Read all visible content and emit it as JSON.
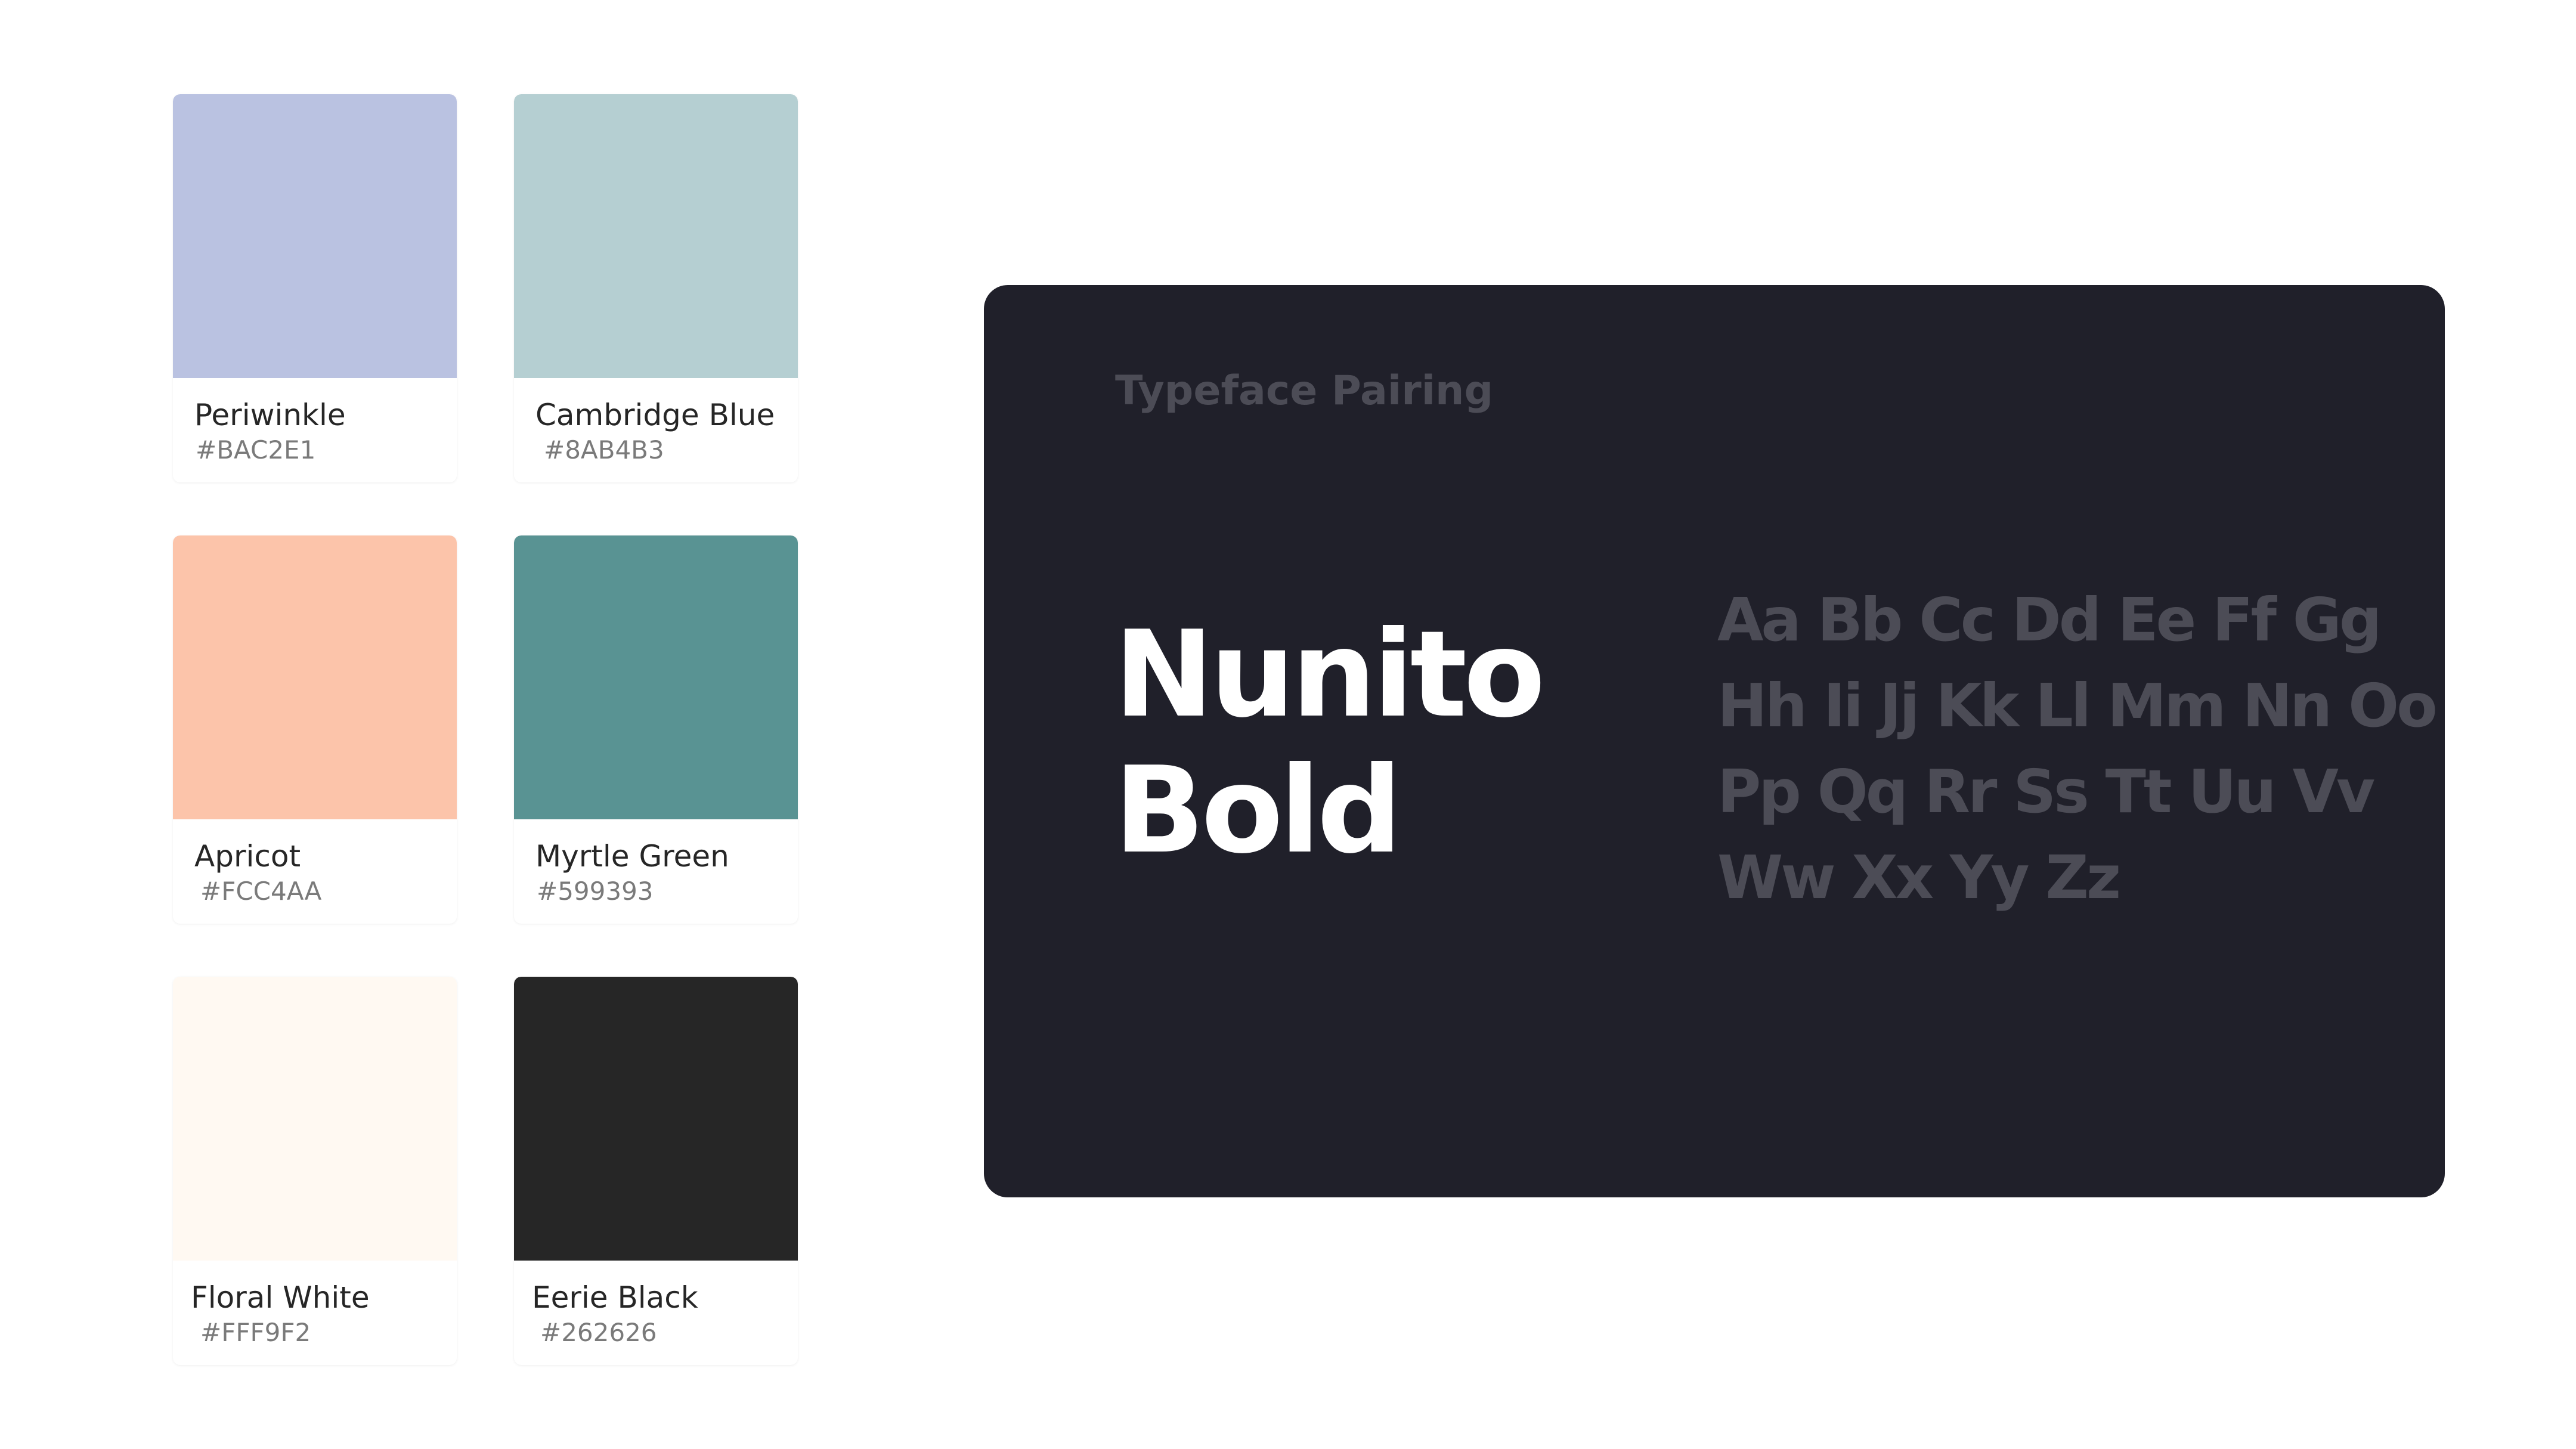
{
  "swatches": [
    {
      "name": "Periwinkle",
      "hex": "#BAC2E1",
      "color": "#BAC2E1"
    },
    {
      "name": "Cambridge Blue",
      "hex": "#8AB4B3",
      "color": "#B5CFD2"
    },
    {
      "name": "Apricot",
      "hex": "#FCC4AA",
      "color": "#FCC4AA"
    },
    {
      "name": "Myrtle Green",
      "hex": "#599393",
      "color": "#599393"
    },
    {
      "name": "Floral White",
      "hex": "#FFF9F2",
      "color": "#FFF9F2"
    },
    {
      "name": "Eerie Black",
      "hex": "#262626",
      "color": "#262626"
    }
  ],
  "typeface": {
    "label": "Typeface Pairing",
    "name_line1": "Nunito",
    "name_line2": "Bold",
    "alphabet": [
      "Aa Bb Cc Dd Ee Ff Gg",
      "Hh Ii Jj Kk Ll Mm Nn Oo",
      "Pp Qq Rr Ss Tt Uu Vv",
      "Ww Xx Yy Zz"
    ]
  },
  "colors": {
    "card_background": "#20202A",
    "muted_text": "#4C4C56",
    "light_text": "#FFFFFF"
  }
}
